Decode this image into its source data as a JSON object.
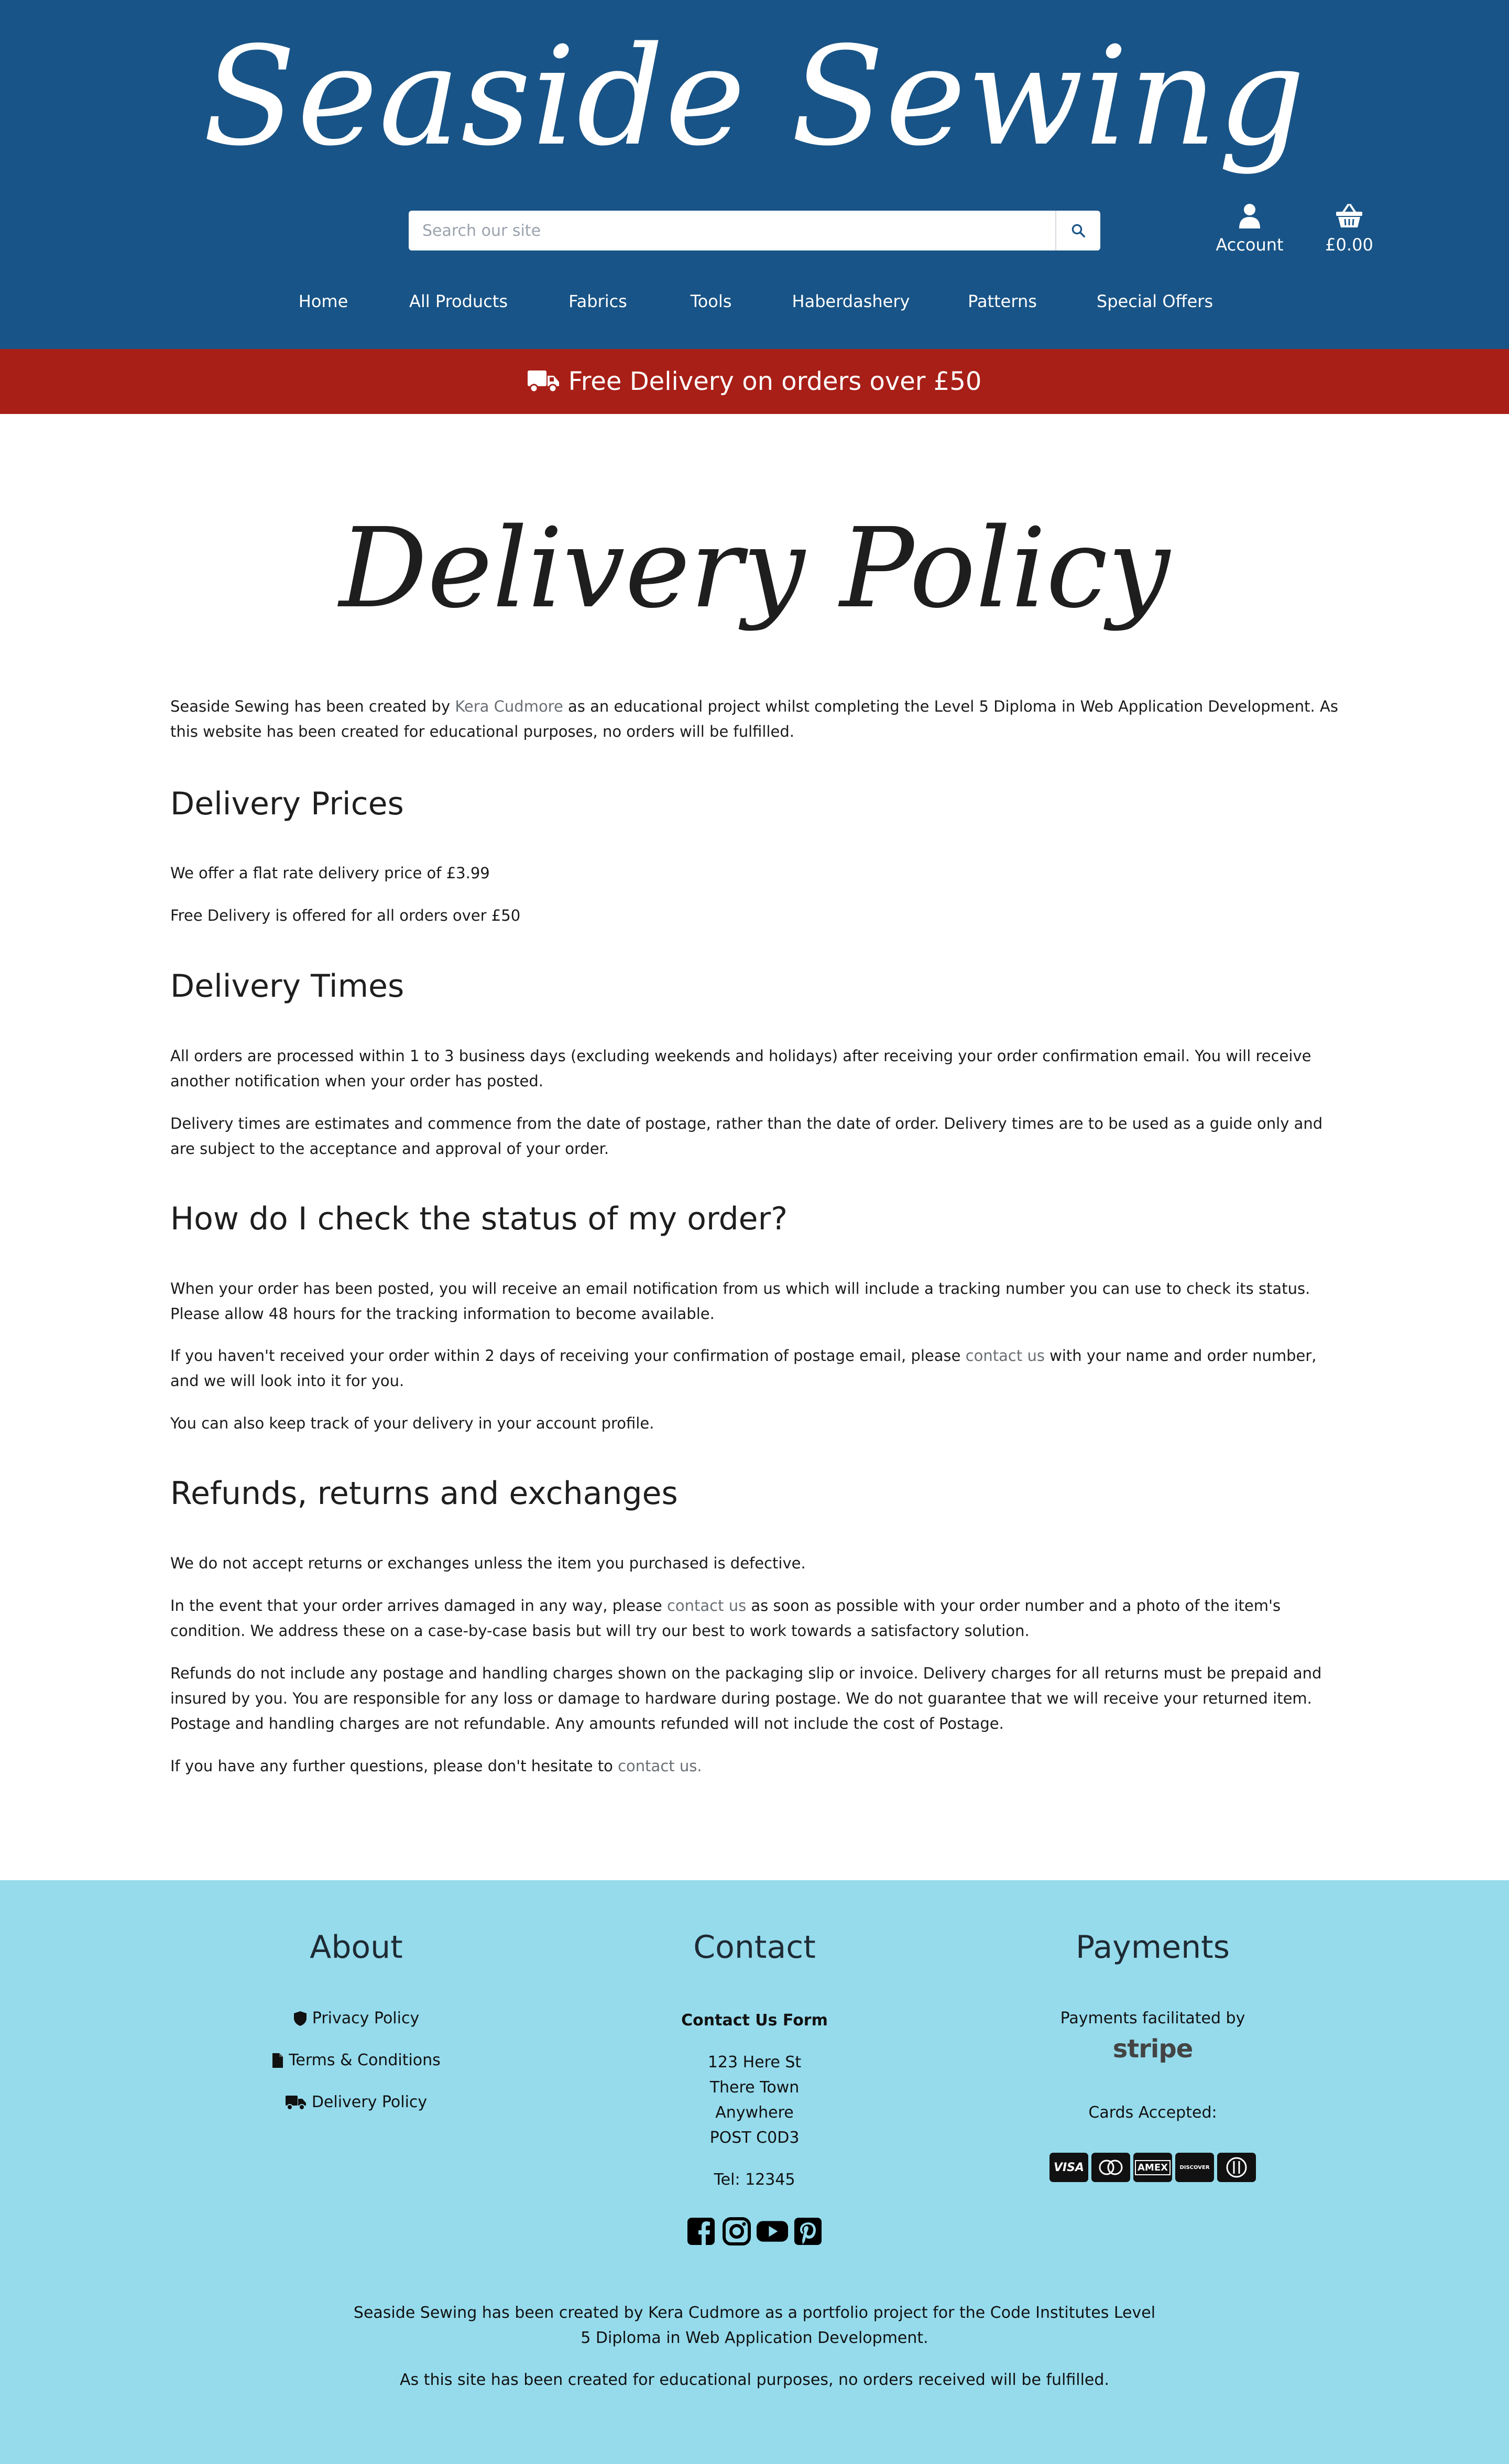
{
  "header": {
    "brand": "Seaside Sewing",
    "search_placeholder": "Search our site",
    "account_label": "Account",
    "basket_total": "£0.00",
    "icons": {
      "search": "search-icon",
      "account": "user-icon",
      "basket": "basket-icon"
    }
  },
  "nav": {
    "items": [
      {
        "label": "Home"
      },
      {
        "label": "All Products"
      },
      {
        "label": "Fabrics"
      },
      {
        "label": "Tools"
      },
      {
        "label": "Haberdashery"
      },
      {
        "label": "Patterns"
      },
      {
        "label": "Special Offers"
      }
    ]
  },
  "banner": {
    "text": "Free Delivery on orders over £50",
    "icon": "truck-icon"
  },
  "colors": {
    "header_bg": "#185487",
    "banner_bg": "#a81f17",
    "footer_bg": "#95dbec",
    "link": "#6a6f74"
  },
  "page": {
    "title": "Delivery Policy",
    "intro": {
      "before": "Seaside Sewing has been created by ",
      "link": "Kera Cudmore",
      "after": " as an educational project whilst completing the Level 5 Diploma in Web Application Development. As this website has been created for educational purposes, no orders will be fulfilled."
    },
    "delivery_prices": {
      "heading": "Delivery Prices",
      "p1": "We offer a flat rate delivery price of £3.99",
      "p2": "Free Delivery is offered for all orders over £50"
    },
    "delivery_times": {
      "heading": "Delivery Times",
      "p1": "All orders are processed within 1 to 3 business days (excluding weekends and holidays) after receiving your order confirmation email. You will receive another notification when your order has posted.",
      "p2": "Delivery times are estimates and commence from the date of postage, rather than the date of order. Delivery times are to be used as a guide only and are subject to the acceptance and approval of your order."
    },
    "status": {
      "heading": "How do I check the status of my order?",
      "p1": "When your order has been posted, you will receive an email notification from us which will include a tracking number you can use to check its status. Please allow 48 hours for the tracking information to become available.",
      "p2_before": "If you haven't received your order within 2 days of receiving your confirmation of postage email, please ",
      "p2_link": "contact us",
      "p2_after": " with your name and order number, and we will look into it for you.",
      "p3": "You can also keep track of your delivery in your account profile."
    },
    "refunds": {
      "heading": "Refunds, returns and exchanges",
      "p1": "We do not accept returns or exchanges unless the item you purchased is defective.",
      "p2_before": "In the event that your order arrives damaged in any way, please ",
      "p2_link": "contact us",
      "p2_after": " as soon as possible with your order number and a photo of the item's condition. We address these on a case-by-case basis but will try our best to work towards a satisfactory solution.",
      "p3": "Refunds do not include any postage and handling charges shown on the packaging slip or invoice. Delivery charges for all returns must be prepaid and insured by you. You are responsible for any loss or damage to hardware during postage. We do not guarantee that we will receive your returned item. Postage and handling charges are not refundable. Any amounts refunded will not include the cost of Postage.",
      "p4_before": "If you have any further questions, please don't hesitate to ",
      "p4_link": "contact us."
    }
  },
  "footer": {
    "about": {
      "heading": "About",
      "links": [
        {
          "label": "Privacy Policy",
          "icon": "shield-icon"
        },
        {
          "label": "Terms & Conditions",
          "icon": "document-icon"
        },
        {
          "label": "Delivery Policy",
          "icon": "truck-icon"
        }
      ]
    },
    "contact": {
      "heading": "Contact",
      "form_link": "Contact Us Form",
      "address": [
        "123 Here St",
        "There Town",
        "Anywhere",
        "POST C0D3"
      ],
      "tel": "Tel: 12345",
      "socials": [
        "facebook-icon",
        "instagram-icon",
        "youtube-icon",
        "pinterest-icon"
      ]
    },
    "payments": {
      "heading": "Payments",
      "facilitated": "Payments facilitated by",
      "provider": "stripe",
      "cards_label": "Cards Accepted:",
      "cards": [
        "VISA",
        "mastercard",
        "AMEX",
        "DISCOVER",
        "diners"
      ]
    },
    "credit": {
      "line1_before": "Seaside Sewing has been created by ",
      "line1_name": "Kera Cudmore",
      "line1_after": " as a portfolio project for the Code Institutes Level",
      "line2": "5 Diploma in Web Application Development.",
      "line3": "As this site has been created for educational purposes, no orders received will be fulfilled."
    }
  }
}
